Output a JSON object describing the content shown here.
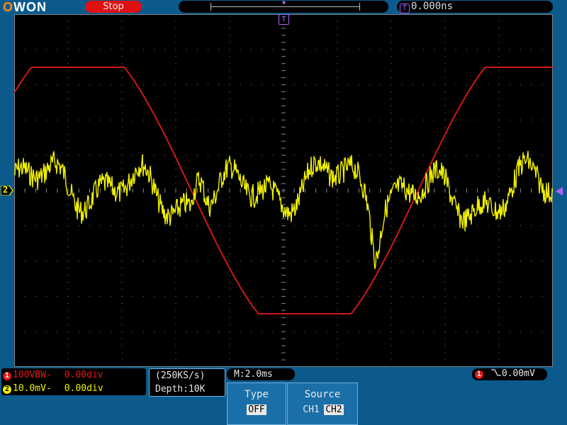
{
  "brand": {
    "text": "OWON"
  },
  "header": {
    "status": "Stop",
    "trigger_position": "0.000ns",
    "trigger_marker": "T"
  },
  "channel_markers": {
    "ch2_left": "2"
  },
  "channels": [
    {
      "id": "1",
      "label": "100VBW-",
      "offset": "0.00div",
      "color": "#e01818"
    },
    {
      "id": "2",
      "label": "10.0mV-",
      "offset": "0.00div",
      "color": "#f0f000"
    }
  ],
  "acquisition": {
    "sample_rate": "(250KS/s)",
    "depth": "Depth:10K"
  },
  "timebase": {
    "main": "M:2.0ms"
  },
  "trigger": {
    "channel": "1",
    "level": "0.00mV"
  },
  "menu": [
    {
      "title": "Type",
      "options": [
        "OFF"
      ],
      "selected": "OFF"
    },
    {
      "title": "Source",
      "options": [
        "CH1",
        "CH2"
      ],
      "selected": "CH2"
    }
  ],
  "colors": {
    "grid": "#808080",
    "ch1_trace": "#d01818",
    "ch2_trace": "#f0f000",
    "trigger_marker": "#b060ff"
  }
}
